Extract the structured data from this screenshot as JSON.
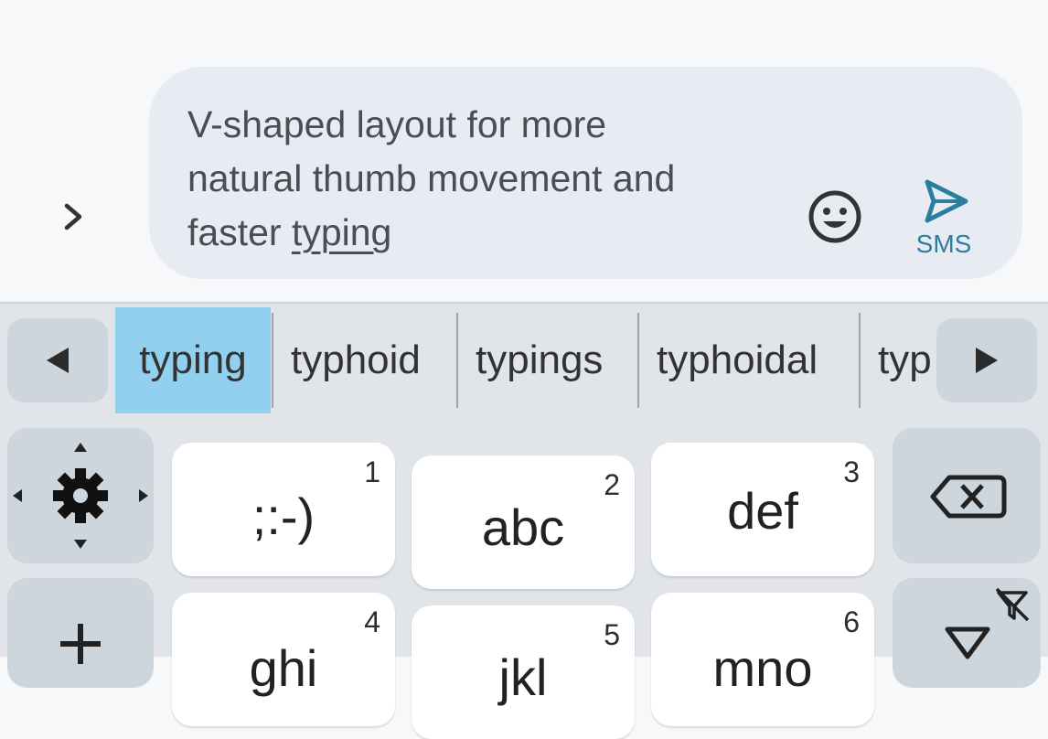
{
  "compose": {
    "message_line1": "V-shaped layout for more",
    "message_line2": "natural thumb movement and",
    "message_line3_prefix": "faster ",
    "message_line3_underlined": "typing",
    "send_label": "SMS"
  },
  "suggestions": [
    "typing",
    "typhoid",
    "typings",
    "typhoidal",
    "typ"
  ],
  "keys": [
    {
      "label": ";:-)",
      "number": "1"
    },
    {
      "label": "abc",
      "number": "2"
    },
    {
      "label": "def",
      "number": "3"
    },
    {
      "label": "ghi",
      "number": "4"
    },
    {
      "label": "jkl",
      "number": "5"
    },
    {
      "label": "mno",
      "number": "6"
    }
  ],
  "colors": {
    "selected_suggestion": "#91d0ee",
    "send_accent": "#2a7fa0",
    "function_key": "#cdd6dd",
    "key_face": "#ffffff"
  },
  "icons": [
    "chevron-right-icon",
    "emoji-icon",
    "send-icon",
    "arrow-left-icon",
    "arrow-right-icon",
    "gear-icon",
    "backspace-icon",
    "plus-icon",
    "filter-off-icon"
  ]
}
